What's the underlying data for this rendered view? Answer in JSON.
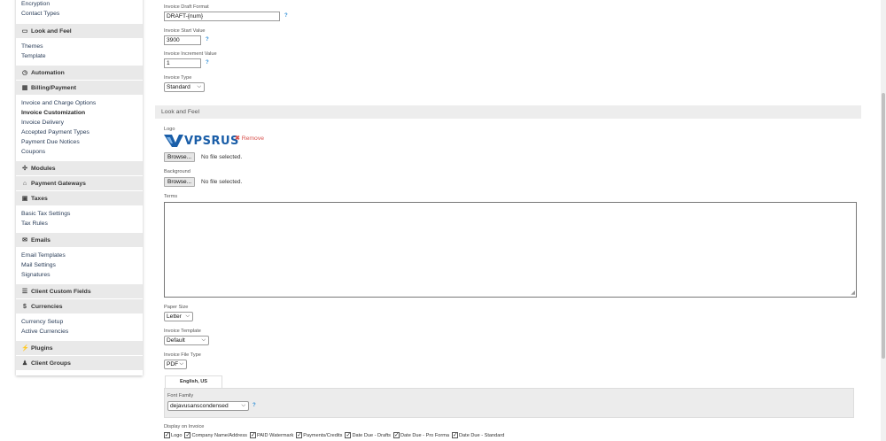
{
  "sidebar": {
    "top_items": [
      "Encryption",
      "Contact Types"
    ],
    "look_feel": {
      "title": "Look and Feel",
      "items": [
        "Themes",
        "Template"
      ]
    },
    "automation": {
      "title": "Automation"
    },
    "billing": {
      "title": "Billing/Payment",
      "items": [
        "Invoice and Charge Options",
        "Invoice Customization",
        "Invoice Delivery",
        "Accepted Payment Types",
        "Payment Due Notices",
        "Coupons"
      ]
    },
    "modules": {
      "title": "Modules"
    },
    "gateways": {
      "title": "Payment Gateways"
    },
    "taxes": {
      "title": "Taxes",
      "items": [
        "Basic Tax Settings",
        "Tax Rules"
      ]
    },
    "emails": {
      "title": "Emails",
      "items": [
        "Email Templates",
        "Mail Settings",
        "Signatures"
      ]
    },
    "custom_fields": {
      "title": "Client Custom Fields"
    },
    "currencies": {
      "title": "Currencies",
      "items": [
        "Currency Setup",
        "Active Currencies"
      ]
    },
    "plugins": {
      "title": "Plugins"
    },
    "client_groups": {
      "title": "Client Groups"
    }
  },
  "form": {
    "draft_format": {
      "label": "Invoice Draft Format",
      "value": "DRAFT-{num}"
    },
    "start_value": {
      "label": "Invoice Start Value",
      "value": "3900"
    },
    "increment_value": {
      "label": "Invoice Increment Value",
      "value": "1"
    },
    "invoice_type": {
      "label": "Invoice Type",
      "value": "Standard"
    },
    "help": "?",
    "chevron": "⌵"
  },
  "look_feel_section": {
    "title": "Look and Feel",
    "logo_label": "Logo",
    "logo_text": "VPSRUS",
    "remove_label": "Remove",
    "browse_label": "Browse...",
    "no_file": "No file selected.",
    "background_label": "Background",
    "terms_label": "Terms",
    "paper_size": {
      "label": "Paper Size",
      "value": "Letter"
    },
    "invoice_template": {
      "label": "Invoice Template",
      "value": "Default"
    },
    "file_type": {
      "label": "Invoice File Type",
      "value": "PDF"
    },
    "tab_label": "English, US",
    "font_family": {
      "label": "Font Family",
      "value": "dejavusanscondensed"
    },
    "display_label": "Display on Invoice",
    "display_options": [
      "Logo",
      "Company Name/Address",
      "PAID Watermark",
      "Payments/Credits",
      "Date Due - Drafts",
      "Date Due - Pro Forma",
      "Date Due - Standard"
    ]
  },
  "colors": {
    "accent": "#2f8ed6",
    "remove": "#d9534f",
    "section_bg": "#ededed",
    "logo_blue": "#1a5ea8"
  }
}
